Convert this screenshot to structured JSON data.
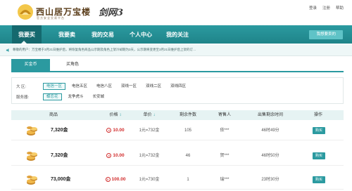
{
  "header": {
    "site_title": "西山居万宝楼",
    "site_subtitle": "官方安全交易平台",
    "game_logo": "剑网3",
    "links": [
      "登录",
      "注册",
      "帮助"
    ]
  },
  "nav": {
    "items": [
      "我要买",
      "我要卖",
      "我的交易",
      "个人中心",
      "我的关注"
    ],
    "sell_button": "我想要卖的"
  },
  "notice": {
    "text": "尊敬的用户：万宝楼于3月21日维护后，将恢复角色商品公示期及角色上架冷却期为3天，公示期将变更至3月21日维护后上架的订…"
  },
  "tabs": [
    "买金币",
    "买角色"
  ],
  "filters": {
    "region_label": "大  区:",
    "regions": [
      "电信一区",
      "电信五区",
      "电信八区",
      "双线一区",
      "双线二区",
      "双线四区"
    ],
    "server_label": "服务器:",
    "servers": [
      "蝶恋花",
      "龙争虎斗",
      "长安城"
    ]
  },
  "table": {
    "headers": [
      "商品",
      "价格",
      "单价",
      "剩余件数",
      "寄售人",
      "出售剩余时间",
      "操作"
    ],
    "sort_icons": [
      "↕",
      "↓"
    ],
    "rows": [
      {
        "goods": "7,320金",
        "price": "10.00",
        "unit": "1元=732金",
        "remaining": "105",
        "seller": "依***",
        "time_left": "46时49分",
        "action": "购买"
      },
      {
        "goods": "7,320金",
        "price": "10.00",
        "unit": "1元=732金",
        "remaining": "46",
        "seller": "贺***",
        "time_left": "46时50分",
        "action": "购买"
      },
      {
        "goods": "73,000金",
        "price": "100.00",
        "unit": "1元=730金",
        "remaining": "1",
        "seller": "瑞***",
        "time_left": "23时30分",
        "action": "购买"
      }
    ]
  },
  "colors": {
    "accent": "#2b9aa0",
    "price": "#d12b2b"
  }
}
